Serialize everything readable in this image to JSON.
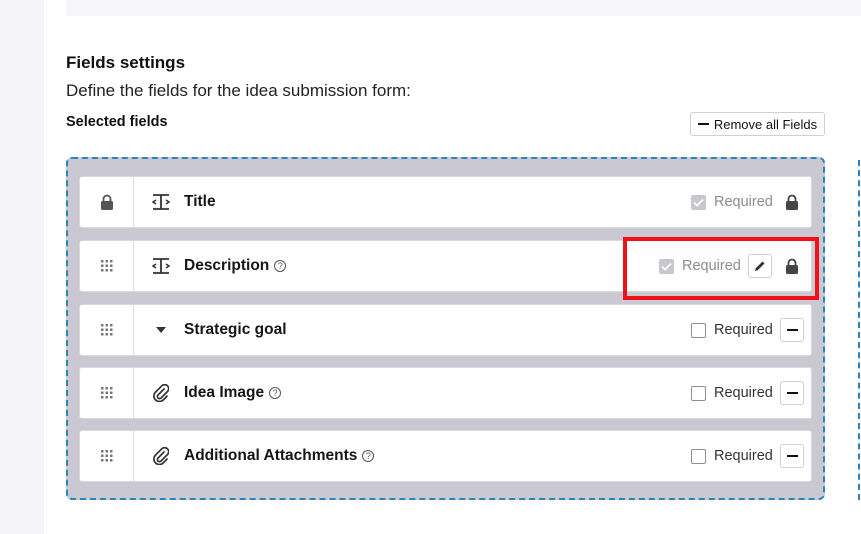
{
  "section": {
    "title": "Fields settings",
    "description": "Define the fields for the idea submission form:",
    "selected_label": "Selected fields",
    "remove_all_label": "Remove all Fields"
  },
  "fields": [
    {
      "name": "Title",
      "type_icon": "text-field-icon",
      "handle_icon": "lock-icon",
      "required": true,
      "required_locked": true,
      "required_label": "Required",
      "has_help": false,
      "actions": [
        "lock-icon"
      ]
    },
    {
      "name": "Description",
      "type_icon": "text-field-icon",
      "handle_icon": "drag-handle-icon",
      "required": true,
      "required_locked": true,
      "required_label": "Required",
      "has_help": true,
      "help_glyph": "?",
      "actions": [
        "edit-icon",
        "lock-icon"
      ]
    },
    {
      "name": "Strategic goal",
      "type_icon": "dropdown-caret-icon",
      "handle_icon": "drag-handle-icon",
      "required": false,
      "required_locked": false,
      "required_label": "Required",
      "has_help": false,
      "actions": [
        "remove-field-button"
      ]
    },
    {
      "name": "Idea Image",
      "type_icon": "paperclip-icon",
      "handle_icon": "drag-handle-icon",
      "required": false,
      "required_locked": false,
      "required_label": "Required",
      "has_help": true,
      "help_glyph": "?",
      "actions": [
        "remove-field-button"
      ]
    },
    {
      "name": "Additional Attachments",
      "type_icon": "paperclip-icon",
      "handle_icon": "drag-handle-icon",
      "required": false,
      "required_locked": false,
      "required_label": "Required",
      "has_help": true,
      "help_glyph": "?",
      "actions": [
        "remove-field-button"
      ]
    }
  ],
  "colors": {
    "dropzone_bg": "#c9c8d3",
    "dropzone_border": "#2a84b8",
    "highlight": "#f0121b"
  }
}
